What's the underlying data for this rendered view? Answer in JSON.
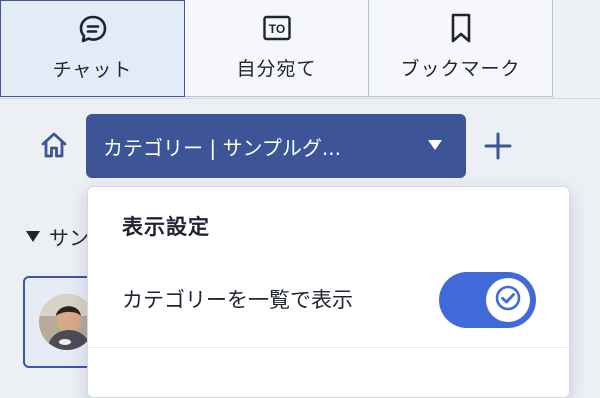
{
  "tabs": [
    {
      "label": "チャット",
      "icon": "chat-bubble-icon"
    },
    {
      "label": "自分宛て",
      "icon": "to-icon",
      "icon_text": "TO"
    },
    {
      "label": "ブックマーク",
      "icon": "bookmark-icon"
    }
  ],
  "toolbar": {
    "home_icon": "home-icon",
    "category_select": "カテゴリー | サンプルグ...",
    "add_icon": "plus-icon"
  },
  "content": {
    "group_header": "サン",
    "card_avatar": "user-avatar"
  },
  "popover": {
    "title": "表示設定",
    "setting_label": "カテゴリーを一覧で表示",
    "toggle_on": true
  },
  "colors": {
    "accent": "#3d5496",
    "toggle": "#3f6ad8",
    "background": "#eceff4",
    "text": "#1f2430"
  }
}
